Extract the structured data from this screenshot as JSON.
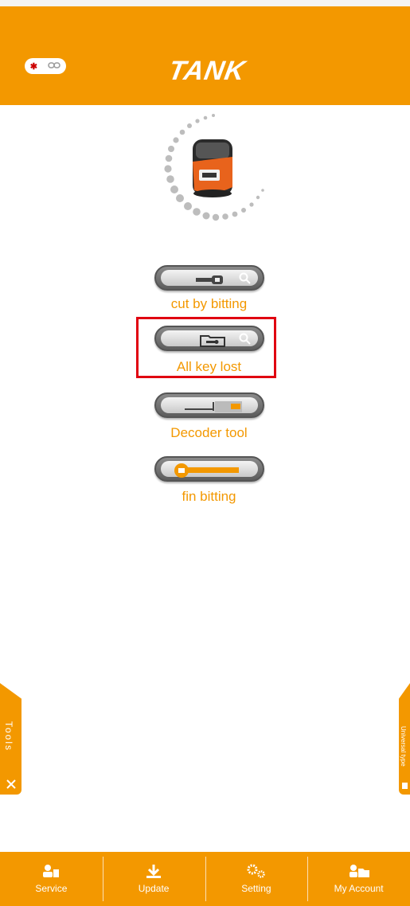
{
  "header": {
    "logo_text": "TANK",
    "connection": {
      "bluetooth_icon": "bluetooth-icon",
      "link_icon": "link-icon"
    }
  },
  "machine": {
    "icon": "key-cutting-machine-icon"
  },
  "menu": [
    {
      "id": "cut-by-bitting",
      "label": "cut by bitting",
      "icon": "key-search-icon"
    },
    {
      "id": "all-key-lost",
      "label": "All key lost",
      "icon": "folder-key-search-icon",
      "highlighted": true
    },
    {
      "id": "decoder-tool",
      "label": "Decoder tool",
      "icon": "decoder-icon"
    },
    {
      "id": "fin-bitting",
      "label": "fin bitting",
      "icon": "orange-key-icon"
    }
  ],
  "side_tabs": {
    "left": {
      "label": "Tools",
      "icon": "tools-icon"
    },
    "right": {
      "label": "Universal type",
      "icon": "universal-type-icon"
    }
  },
  "bottom_nav": [
    {
      "label": "Service",
      "icon": "service-icon"
    },
    {
      "label": "Update",
      "icon": "download-icon"
    },
    {
      "label": "Setting",
      "icon": "gears-icon"
    },
    {
      "label": "My Account",
      "icon": "account-folder-icon"
    }
  ],
  "colors": {
    "accent": "#f39800",
    "highlight": "#e00010"
  }
}
